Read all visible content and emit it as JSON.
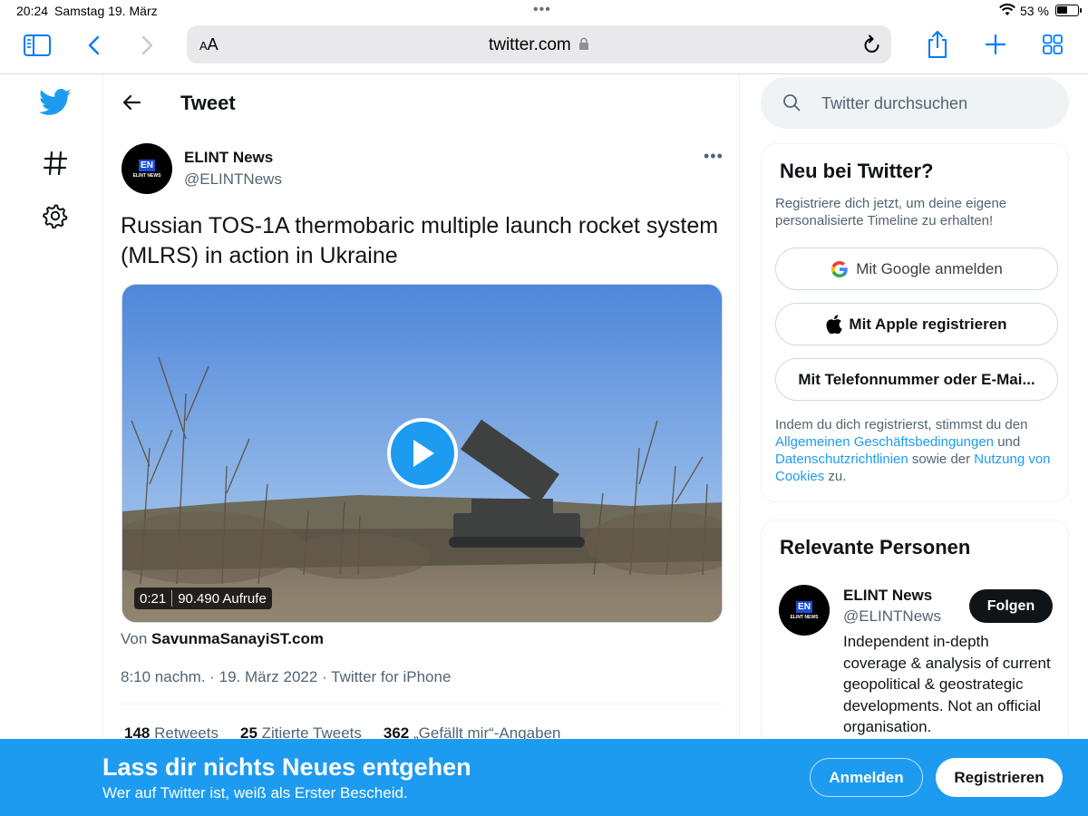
{
  "status_bar": {
    "time": "20:24",
    "date": "Samstag 19. März",
    "battery_text": "53 %",
    "battery_level": 0.53
  },
  "browser": {
    "text_size_label": "AA",
    "host": "twitter.com",
    "icons": [
      "sidebar-icon",
      "back-icon",
      "forward-icon",
      "lock-icon",
      "reload-icon",
      "share-icon",
      "new-tab-icon",
      "tabs-icon"
    ]
  },
  "left_nav": {
    "icons": [
      "twitter-logo-icon",
      "hashtag-icon",
      "gear-icon"
    ]
  },
  "header": {
    "title": "Tweet"
  },
  "tweet": {
    "author_name": "ELINT News",
    "author_handle": "@ELINTNews",
    "avatar_badge": "EN",
    "avatar_text": "ELINT NEWS",
    "text": "Russian TOS-1A thermobaric multiple launch rocket system (MLRS) in action in Ukraine",
    "video_duration": "0:21",
    "video_views": "90.490 Aufrufe",
    "source_prefix": "Von",
    "source_name": "SavunmaSanayiST.com",
    "timestamp": "8:10 nachm. · 19. März 2022 · Twitter for iPhone",
    "stats": [
      {
        "count": "148",
        "label": "Retweets"
      },
      {
        "count": "25",
        "label": "Zitierte Tweets"
      },
      {
        "count": "362",
        "label": "„Gefällt mir“-Angaben"
      }
    ]
  },
  "search": {
    "placeholder": "Twitter durchsuchen"
  },
  "signup_card": {
    "title": "Neu bei Twitter?",
    "description": "Registriere dich jetzt, um deine eigene personalisierte Timeline zu erhalten!",
    "google_label": "Mit Google anmelden",
    "apple_label": "Mit Apple registrieren",
    "phone_label": "Mit Telefonnummer oder E-Mai...",
    "legal_prefix": "Indem du dich registrierst, stimmst du den",
    "legal_link_terms": "Allgemeinen Geschäftsbedingungen",
    "legal_and": "und",
    "legal_link_privacy": "Datenschutzrichtlinien",
    "legal_middle": "sowie der",
    "legal_link_cookies": "Nutzung von Cookies",
    "legal_suffix": "zu."
  },
  "people_card": {
    "title": "Relevante Personen",
    "name": "ELINT News",
    "handle": "@ELINTNews",
    "follow_label": "Folgen",
    "bio": "Independent in-depth coverage & analysis of current geopolitical & geostrategic developments. Not an official organisation."
  },
  "banner": {
    "title": "Lass dir nichts Neues entgehen",
    "subtitle": "Wer auf Twitter ist, weiß als Erster Bescheid.",
    "login_label": "Anmelden",
    "signup_label": "Registrieren"
  },
  "colors": {
    "accent": "#1d9bf0",
    "safari_blue": "#007aff",
    "text_primary": "#0f1419",
    "text_secondary": "#536471"
  }
}
